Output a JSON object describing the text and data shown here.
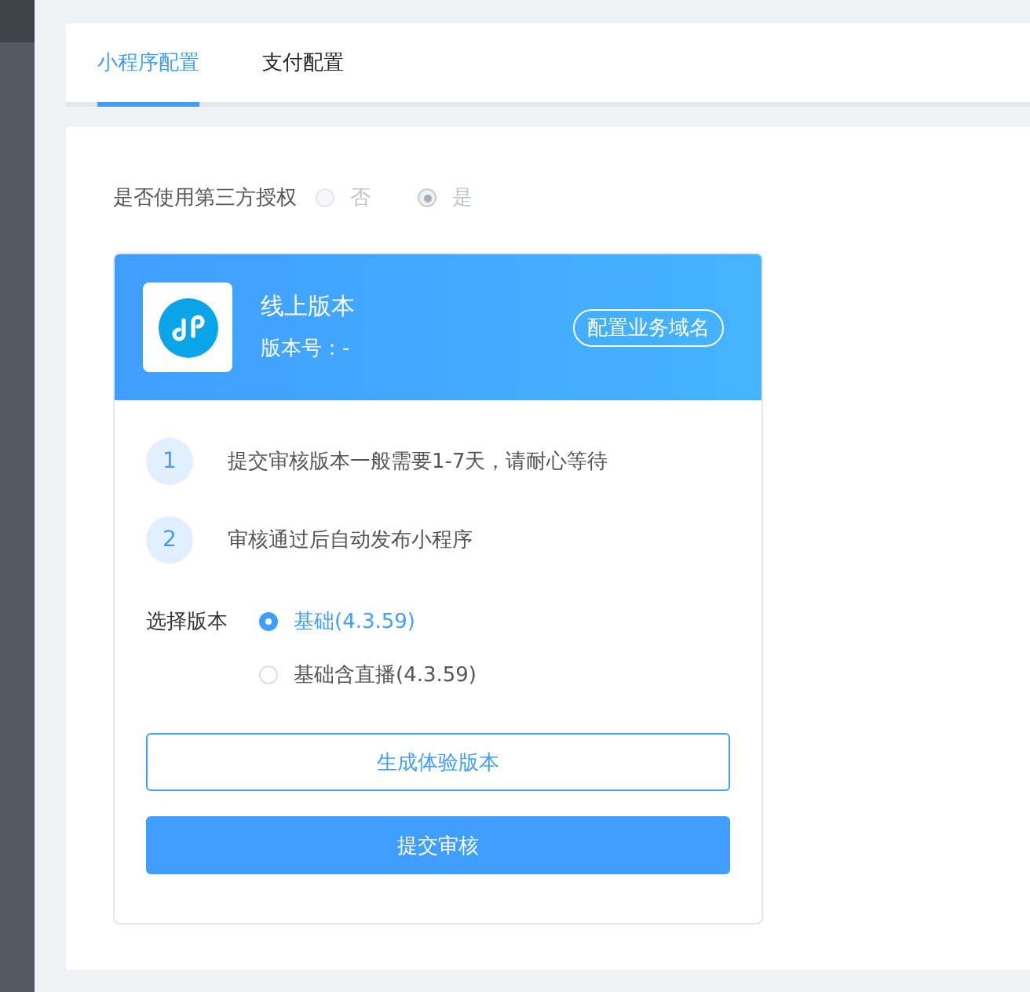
{
  "tabs": [
    {
      "label": "小程序配置",
      "selected": true
    },
    {
      "label": "支付配置",
      "selected": false
    }
  ],
  "third_party_auth": {
    "label": "是否使用第三方授权",
    "disabled": true,
    "options": [
      {
        "label": "否",
        "selected": false
      },
      {
        "label": "是",
        "selected": true
      }
    ]
  },
  "version_card": {
    "title": "线上版本",
    "version": "版本号：-",
    "domain_button": "配置业务域名",
    "steps": [
      {
        "number": "1",
        "text": "提交审核版本一般需要1-7天，请耐心等待"
      },
      {
        "number": "2",
        "text": "审核通过后自动发布小程序"
      }
    ],
    "select_label": "选择版本",
    "options": [
      {
        "label": "基础(4.3.59)",
        "selected": true
      },
      {
        "label": "基础含直播(4.3.59)",
        "selected": false
      }
    ],
    "buttons": [
      {
        "label": "生成体验版本",
        "kind": "outline"
      },
      {
        "label": "提交审核",
        "kind": "primary"
      }
    ]
  }
}
